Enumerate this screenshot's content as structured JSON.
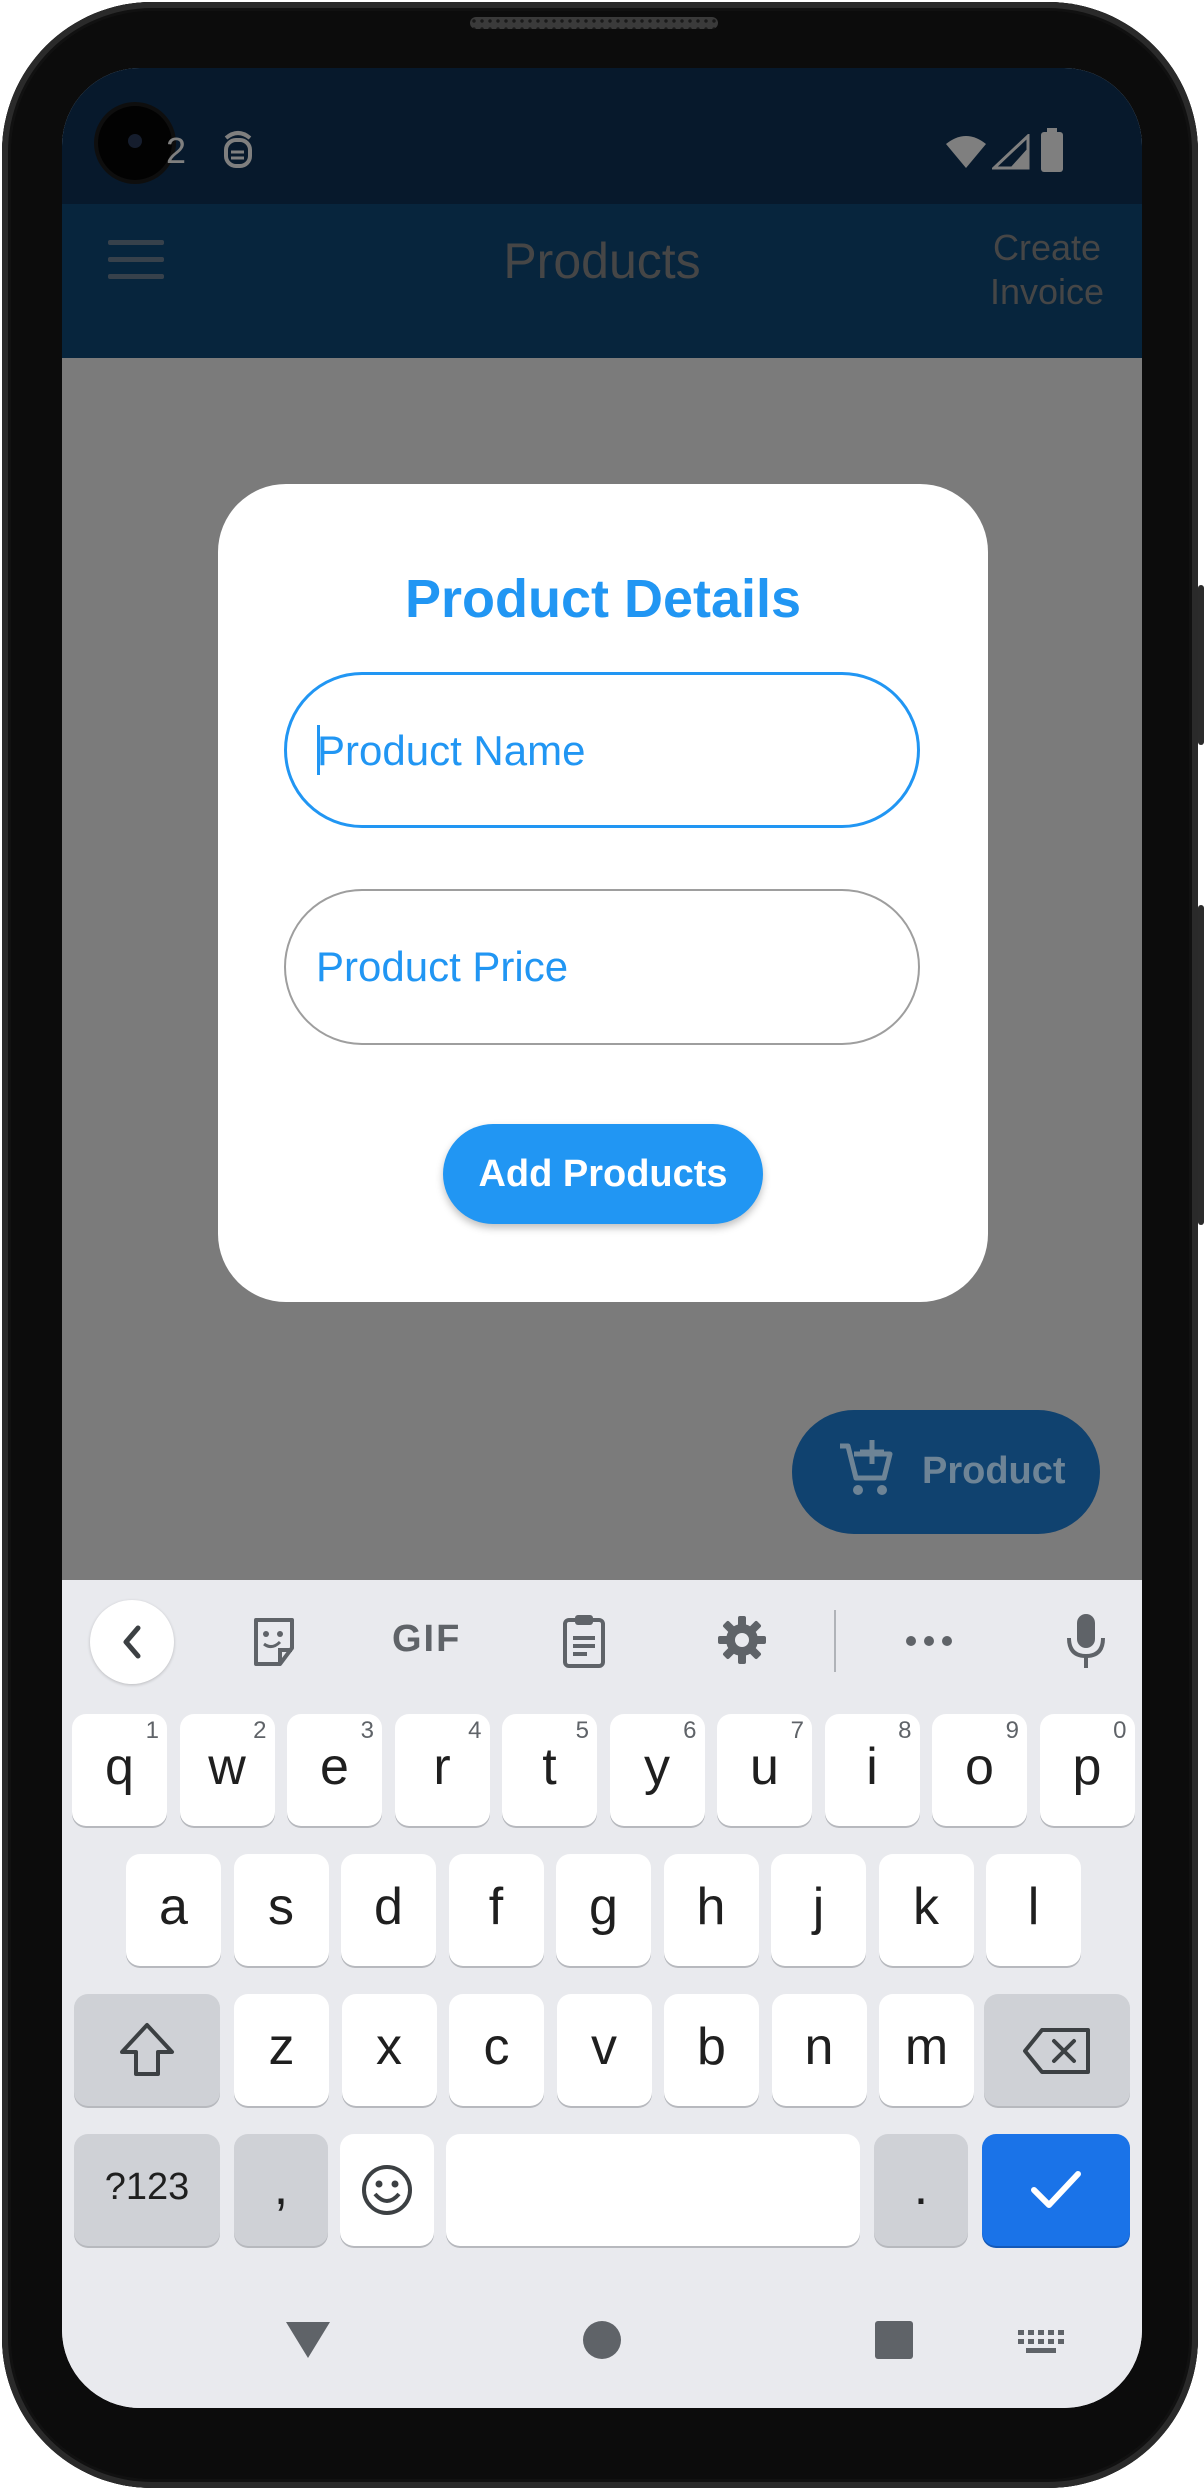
{
  "status_bar": {
    "time_fragment": "2",
    "notification_icon": "assistant-icon",
    "icons": [
      "wifi-icon",
      "signal-icon",
      "battery-icon"
    ]
  },
  "app_bar": {
    "title": "Products",
    "action_line1": "Create",
    "action_line2": "Invoice",
    "menu_icon": "hamburger-menu-icon"
  },
  "dialog": {
    "title": "Product Details",
    "product_name_placeholder": "Product Name",
    "product_name_value": "",
    "product_price_placeholder": "Product Price",
    "product_price_value": "",
    "button_label": "Add Products"
  },
  "fab": {
    "label": "Product",
    "icon": "add-shopping-cart-icon"
  },
  "keyboard": {
    "toolbar": [
      "back-chevron-icon",
      "sticker-icon",
      "gif-icon",
      "clipboard-icon",
      "settings-gear-icon",
      "more-icon",
      "microphone-icon"
    ],
    "gif_label": "GIF",
    "row1": [
      {
        "k": "q",
        "s": "1"
      },
      {
        "k": "w",
        "s": "2"
      },
      {
        "k": "e",
        "s": "3"
      },
      {
        "k": "r",
        "s": "4"
      },
      {
        "k": "t",
        "s": "5"
      },
      {
        "k": "y",
        "s": "6"
      },
      {
        "k": "u",
        "s": "7"
      },
      {
        "k": "i",
        "s": "8"
      },
      {
        "k": "o",
        "s": "9"
      },
      {
        "k": "p",
        "s": "0"
      }
    ],
    "row2": [
      "a",
      "s",
      "d",
      "f",
      "g",
      "h",
      "j",
      "k",
      "l"
    ],
    "row3": [
      "z",
      "x",
      "c",
      "v",
      "b",
      "n",
      "m"
    ],
    "symbols_key": "?123",
    "comma_key": ",",
    "period_key": ".",
    "enter_icon": "checkmark-icon"
  },
  "nav_bar": {
    "icons": [
      "back-triangle-icon",
      "home-circle-icon",
      "recents-square-icon",
      "keyboard-switch-icon"
    ]
  },
  "colors": {
    "accent": "#2196f3",
    "status_bar": "#0e3358",
    "app_bar": "#0f4a7b",
    "enter_key": "#1a73e8"
  }
}
